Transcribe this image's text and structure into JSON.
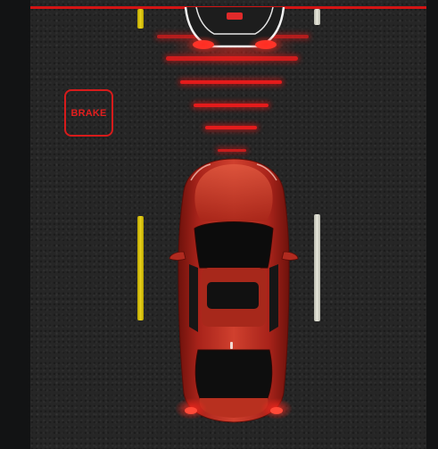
{
  "scene": {
    "alert_label": "BRAKE",
    "alert_color": "#d71b1b",
    "road_color": "#262626",
    "ego_car_color": "#b9261a",
    "lead_car_outline_color": "#ffffff",
    "lane_mark_left_color": "yellow",
    "lane_mark_right_color": "white"
  }
}
